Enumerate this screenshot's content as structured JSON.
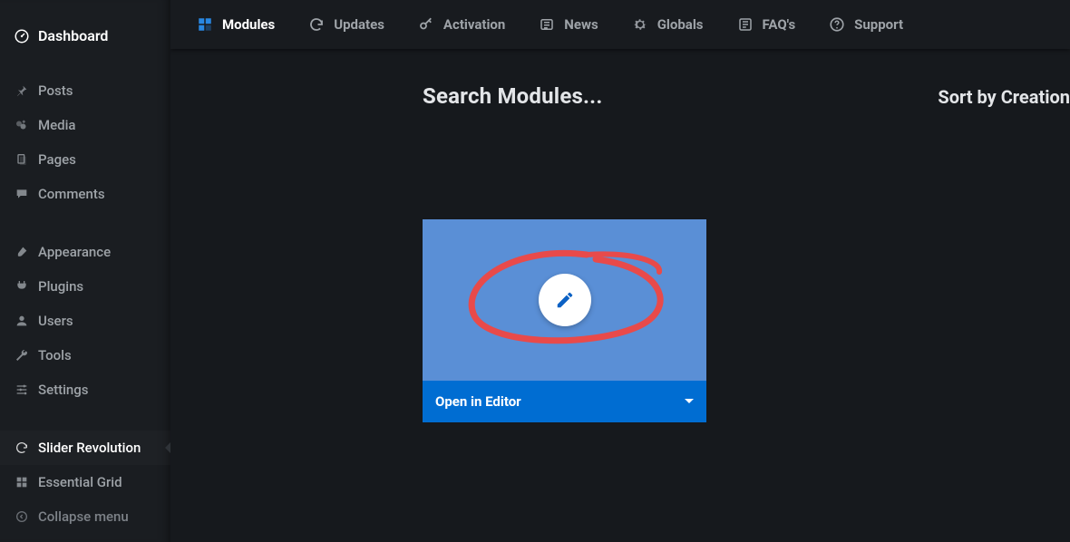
{
  "sidebar": {
    "current": "Dashboard",
    "items_a": [
      {
        "label": "Posts"
      },
      {
        "label": "Media"
      },
      {
        "label": "Pages"
      },
      {
        "label": "Comments"
      }
    ],
    "items_b": [
      {
        "label": "Appearance"
      },
      {
        "label": "Plugins"
      },
      {
        "label": "Users"
      },
      {
        "label": "Tools"
      },
      {
        "label": "Settings"
      }
    ],
    "items_c": [
      {
        "label": "Slider Revolution",
        "selected": true
      },
      {
        "label": "Essential Grid"
      },
      {
        "label": "Collapse menu",
        "dim": true
      }
    ]
  },
  "topnav": {
    "tabs": [
      {
        "label": "Modules",
        "active": true
      },
      {
        "label": "Updates"
      },
      {
        "label": "Activation"
      },
      {
        "label": "News"
      },
      {
        "label": "Globals"
      },
      {
        "label": "FAQ's"
      },
      {
        "label": "Support"
      }
    ]
  },
  "content": {
    "search_label": "Search Modules...",
    "sort_label": "Sort by Creation",
    "card": {
      "action_label": "Open in Editor"
    }
  },
  "colors": {
    "accent": "#006dd2",
    "annotation": "#e84a4a"
  }
}
